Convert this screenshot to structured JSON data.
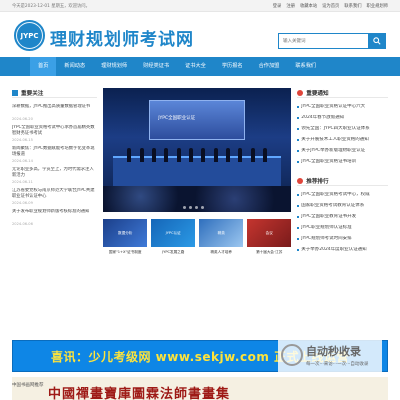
{
  "topbar": {
    "left": "今天是2023-12-01 星期五，欢迎访问。",
    "items": [
      "登录",
      "注册",
      "收藏本站",
      "设为首页",
      "联系我们",
      "职业规划师"
    ]
  },
  "header": {
    "logo": "JYPC",
    "title": "理财规划师考试网",
    "search_placeholder": "输入关键词"
  },
  "nav": [
    "首页",
    "新闻动态",
    "理财规划师",
    "财经类证书",
    "证书大全",
    "学历报名",
    "合作加盟",
    "联系我们"
  ],
  "left": {
    "title": "重要关注",
    "items": [
      {
        "t": "深耕数据，JYPC推出高质量数据管理证书",
        "d": "2024-06-20"
      },
      {
        "t": "JYPC全国职业资格考试中心承办首届精英数智财务证书考试",
        "d": "2024-06-15"
      },
      {
        "t": "新闻聚焦：JYPC数据赋能考培数字化变革现场报道",
        "d": "2024-06-14"
      },
      {
        "t": "无论职业多高，学员至上，为时代需求注入新活力",
        "d": "2024-06-11"
      },
      {
        "t": "江苏省委党校与南京师范大学联合JYPC共建职业证书认证中心",
        "d": "2024-06-09"
      },
      {
        "t": "关于发布职业规划师新版考核标准的通知",
        "d": "2024-06-06"
      }
    ]
  },
  "banner": {
    "screen_text": "JYPC全国职业认证"
  },
  "thumbs": [
    {
      "label": "数据分析",
      "cap": "国家\"1+X\"证书制度"
    },
    {
      "label": "JYPC认证",
      "cap": "JYPC发展之路"
    },
    {
      "label": "精英",
      "cap": "精英人才培养"
    },
    {
      "label": "会议",
      "cap": "第十届大会·江苏"
    }
  ],
  "right": {
    "news_title": "重要通知",
    "news": [
      "JYPC全国职业资格认证中心六大",
      "2024年春节放假通知",
      "领先全国：JYPC四大职业认证体系",
      "关于开展技术工人职业资格的通知",
      "关于JYPC举办新版理财职业认证",
      "JYPC全国职业资格证书培训"
    ],
    "rank_title": "推荐排行",
    "rank": [
      "JYPC全国职业资格考试中心，权威",
      "国家职业资格考试教育认证体系",
      "JYPC全国职业教育证书开发",
      "JYPC职业规划师认证标准",
      "JYPC规划师考试时间安排",
      "关于举办2024年度职业认证通知"
    ]
  },
  "ad": {
    "text": "喜讯：少儿考级网 www.sekjw.com 正式上线运营"
  },
  "ad2": {
    "text": "中國禪畫寶庫圖霖法師書畫集"
  },
  "watermark": {
    "title": "自动秒收录",
    "sub": "每一次···来访···一次···自动收录"
  },
  "bottom": {
    "text": "中国书画网推荐"
  }
}
